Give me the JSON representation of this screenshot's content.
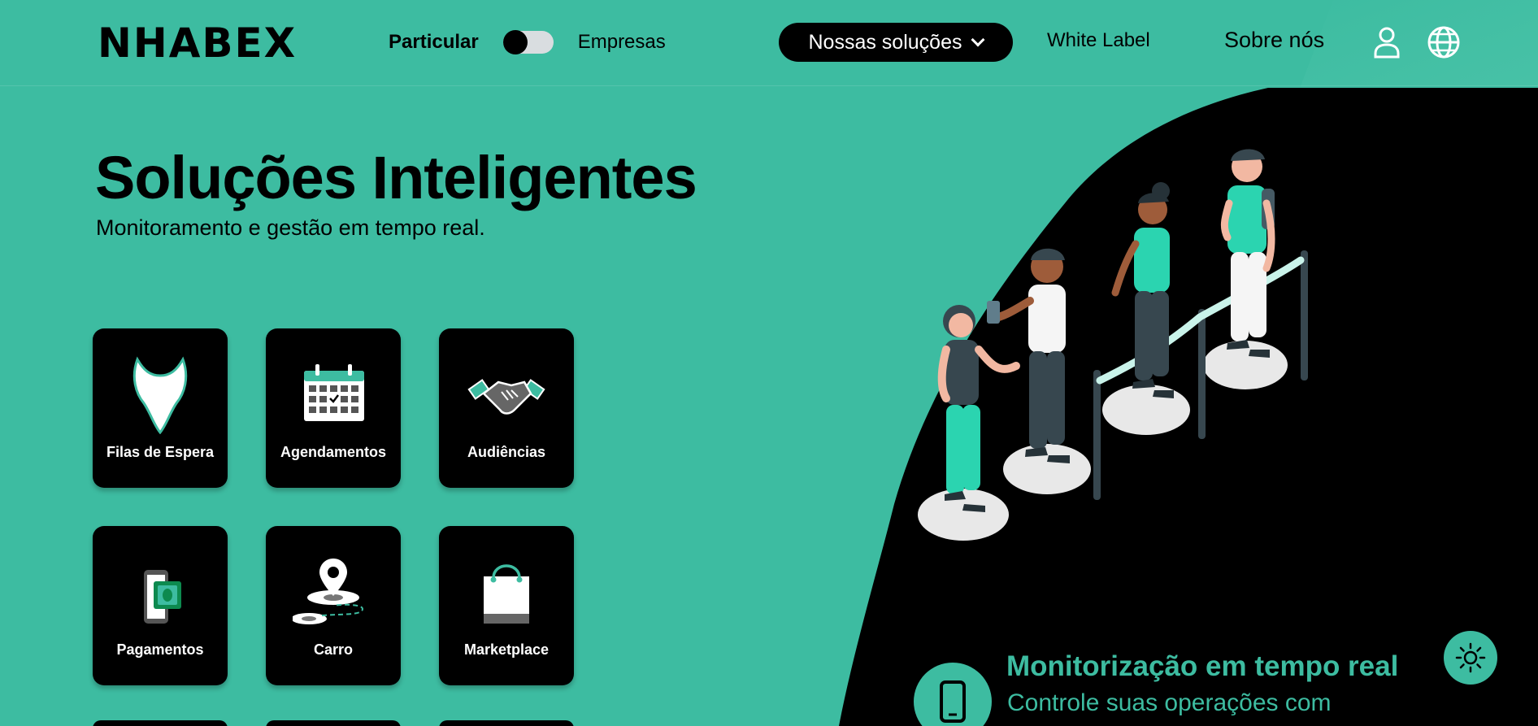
{
  "header": {
    "logo": "NHABEX",
    "toggle": {
      "left_label": "Particular",
      "right_label": "Empresas",
      "state": "off"
    },
    "nav": {
      "solutions_label": "Nossas soluções",
      "white_label": "White Label",
      "about": "Sobre nós"
    }
  },
  "hero": {
    "title": "Soluções Inteligentes",
    "subtitle": "Monitoramento e gestão em tempo real."
  },
  "tiles": [
    {
      "label": "Filas de Espera",
      "icon": "waiting-line-icon"
    },
    {
      "label": "Agendamentos",
      "icon": "calendar-icon"
    },
    {
      "label": "Audiências",
      "icon": "handshake-icon"
    },
    {
      "label": "Pagamentos",
      "icon": "payment-phone-icon"
    },
    {
      "label": "Carro",
      "icon": "location-pin-icon"
    },
    {
      "label": "Marketplace",
      "icon": "shopping-bag-icon"
    }
  ],
  "feature": {
    "title": "Monitorização em tempo real",
    "subtitle": "Controle suas operações com"
  },
  "colors": {
    "background": "#3dbca1",
    "dark": "#000000",
    "accent": "#3dbca1",
    "light_accent": "#2fd3b0"
  }
}
